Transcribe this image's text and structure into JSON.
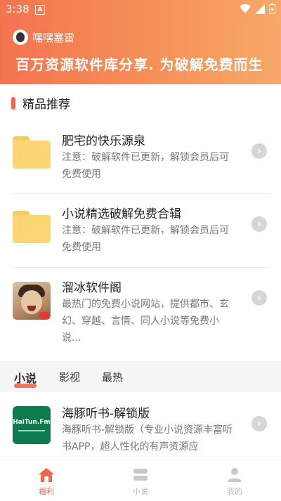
{
  "status_bar": {
    "time": "3:38",
    "notification_icon": "A"
  },
  "header": {
    "username": "嘿嘿塞雷",
    "slogan": "百万资源软件库分享. 为破解免费而生"
  },
  "section": {
    "title": "精品推荐"
  },
  "items": [
    {
      "title": "肥宅的快乐源泉",
      "desc": "注意：破解软件已更新，解锁会员后可免费使用",
      "icon": "folder-icon"
    },
    {
      "title": "小说精选破解免费合辑",
      "desc": "注意：破解软件已更新，解锁会员后可免费使用",
      "icon": "folder-icon"
    },
    {
      "title": "溜冰软件阁",
      "desc": "最热门的免费小说网站，提供都市、玄幻、穿越、言情、同人小说等免费小说...",
      "icon": "photo-thumbnail"
    },
    {
      "title": "海豚听书-解锁版",
      "desc": "海豚听书-解锁版（专业小说资源丰富听书APP，超人性化的有声资源应",
      "icon": "haitun-app-icon",
      "logo_text": "HaiTun.Fm"
    }
  ],
  "tabs": [
    "小说",
    "影视",
    "最热"
  ],
  "active_tab": "小说",
  "bottom_nav": [
    {
      "label": "福利",
      "icon": "home-icon",
      "active": true
    },
    {
      "label": "小说",
      "icon": "stack-icon",
      "active": false
    },
    {
      "label": "我的",
      "icon": "person-icon",
      "active": false
    }
  ],
  "colors": {
    "accent": "#f4674d",
    "header_start": "#f4734f",
    "header_end": "#f8a86a",
    "inactive": "#bbbbbb"
  }
}
